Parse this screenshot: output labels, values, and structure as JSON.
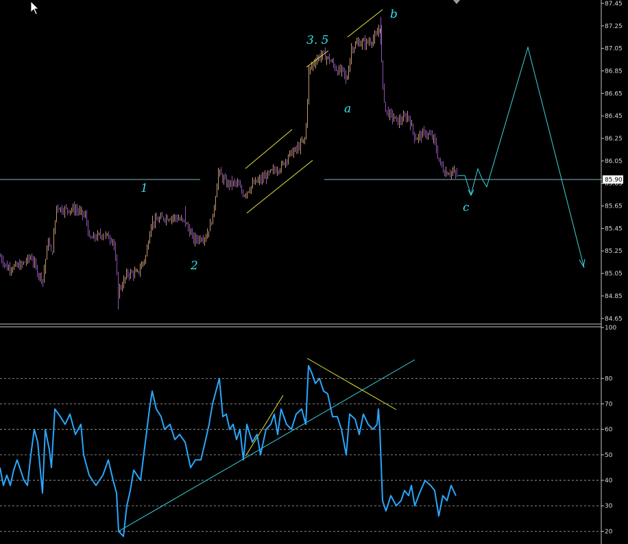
{
  "chart_data": [
    {
      "type": "bar",
      "style": "ohlc-price",
      "ylim": [
        84.6,
        87.48
      ],
      "yticks": [
        87.45,
        87.25,
        87.05,
        86.85,
        86.65,
        86.45,
        86.25,
        86.05,
        85.85,
        85.65,
        85.45,
        85.25,
        85.05,
        84.85,
        84.65
      ],
      "current_price": "85.90",
      "price_path": [
        [
          0,
          85.2
        ],
        [
          10,
          85.1
        ],
        [
          30,
          85.12
        ],
        [
          45,
          85.2
        ],
        [
          55,
          85.05
        ],
        [
          62,
          85.0
        ],
        [
          70,
          85.35
        ],
        [
          75,
          85.2
        ],
        [
          82,
          85.65
        ],
        [
          90,
          85.62
        ],
        [
          110,
          85.62
        ],
        [
          125,
          85.55
        ],
        [
          130,
          85.35
        ],
        [
          150,
          85.4
        ],
        [
          165,
          85.35
        ],
        [
          172,
          84.9
        ],
        [
          178,
          84.95
        ],
        [
          185,
          85.05
        ],
        [
          200,
          85.05
        ],
        [
          212,
          85.2
        ],
        [
          220,
          85.5
        ],
        [
          240,
          85.55
        ],
        [
          255,
          85.55
        ],
        [
          270,
          85.5
        ],
        [
          282,
          85.35
        ],
        [
          300,
          85.38
        ],
        [
          310,
          85.55
        ],
        [
          318,
          85.95
        ],
        [
          330,
          85.85
        ],
        [
          345,
          85.85
        ],
        [
          355,
          85.75
        ],
        [
          370,
          85.85
        ],
        [
          385,
          85.9
        ],
        [
          395,
          85.95
        ],
        [
          410,
          86.0
        ],
        [
          420,
          86.1
        ],
        [
          432,
          86.15
        ],
        [
          445,
          86.25
        ],
        [
          450,
          86.85
        ],
        [
          460,
          86.95
        ],
        [
          470,
          87.0
        ],
        [
          480,
          86.95
        ],
        [
          492,
          86.85
        ],
        [
          500,
          86.85
        ],
        [
          505,
          86.75
        ],
        [
          512,
          87.05
        ],
        [
          522,
          87.1
        ],
        [
          535,
          87.1
        ],
        [
          548,
          87.15
        ],
        [
          554,
          87.25
        ],
        [
          557,
          86.75
        ],
        [
          562,
          86.5
        ],
        [
          570,
          86.45
        ],
        [
          580,
          86.4
        ],
        [
          595,
          86.45
        ],
        [
          605,
          86.25
        ],
        [
          620,
          86.3
        ],
        [
          632,
          86.25
        ],
        [
          640,
          86.05
        ],
        [
          648,
          85.95
        ],
        [
          660,
          85.95
        ],
        [
          667,
          85.92
        ]
      ],
      "wave_labels": [
        "1",
        "2",
        "3. 5",
        "a",
        "b",
        "c"
      ],
      "projection": [
        [
          668,
          85.92
        ],
        [
          678,
          85.92
        ],
        [
          687,
          85.75
        ],
        [
          697,
          85.98
        ],
        [
          704,
          85.88
        ],
        [
          710,
          85.82
        ],
        [
          770,
          87.06
        ],
        [
          852,
          85.1
        ]
      ]
    },
    {
      "type": "line",
      "style": "oscillator",
      "ylim": [
        15,
        100
      ],
      "yticks": [
        100,
        80,
        70,
        60,
        50,
        40,
        30,
        20
      ],
      "gridlines": [
        80,
        70,
        60,
        50,
        40,
        30,
        20
      ],
      "line_color": "#2aa8ff",
      "values": [
        [
          0,
          45
        ],
        [
          5,
          38
        ],
        [
          10,
          42
        ],
        [
          15,
          38
        ],
        [
          20,
          44
        ],
        [
          25,
          48
        ],
        [
          30,
          44
        ],
        [
          35,
          40
        ],
        [
          40,
          38
        ],
        [
          45,
          50
        ],
        [
          50,
          60
        ],
        [
          55,
          55
        ],
        [
          62,
          35
        ],
        [
          66,
          60
        ],
        [
          72,
          52
        ],
        [
          75,
          45
        ],
        [
          80,
          68
        ],
        [
          88,
          65
        ],
        [
          95,
          62
        ],
        [
          102,
          66
        ],
        [
          110,
          58
        ],
        [
          118,
          62
        ],
        [
          122,
          50
        ],
        [
          130,
          42
        ],
        [
          140,
          38
        ],
        [
          150,
          42
        ],
        [
          158,
          48
        ],
        [
          165,
          40
        ],
        [
          170,
          35
        ],
        [
          173,
          20
        ],
        [
          180,
          18
        ],
        [
          185,
          30
        ],
        [
          190,
          36
        ],
        [
          195,
          44
        ],
        [
          205,
          40
        ],
        [
          212,
          55
        ],
        [
          218,
          68
        ],
        [
          222,
          75
        ],
        [
          228,
          68
        ],
        [
          235,
          65
        ],
        [
          240,
          60
        ],
        [
          248,
          62
        ],
        [
          255,
          56
        ],
        [
          262,
          58
        ],
        [
          270,
          55
        ],
        [
          278,
          45
        ],
        [
          285,
          48
        ],
        [
          293,
          48
        ],
        [
          300,
          56
        ],
        [
          305,
          62
        ],
        [
          310,
          70
        ],
        [
          315,
          75
        ],
        [
          320,
          80
        ],
        [
          325,
          65
        ],
        [
          330,
          66
        ],
        [
          335,
          60
        ],
        [
          340,
          62
        ],
        [
          345,
          56
        ],
        [
          350,
          60
        ],
        [
          355,
          48
        ],
        [
          360,
          62
        ],
        [
          368,
          55
        ],
        [
          375,
          58
        ],
        [
          380,
          50
        ],
        [
          388,
          60
        ],
        [
          395,
          62
        ],
        [
          400,
          66
        ],
        [
          405,
          58
        ],
        [
          410,
          68
        ],
        [
          418,
          62
        ],
        [
          425,
          60
        ],
        [
          432,
          66
        ],
        [
          440,
          68
        ],
        [
          446,
          62
        ],
        [
          450,
          85
        ],
        [
          455,
          82
        ],
        [
          460,
          78
        ],
        [
          466,
          80
        ],
        [
          472,
          75
        ],
        [
          478,
          74
        ],
        [
          485,
          65
        ],
        [
          492,
          65
        ],
        [
          498,
          60
        ],
        [
          505,
          50
        ],
        [
          510,
          66
        ],
        [
          518,
          64
        ],
        [
          524,
          58
        ],
        [
          530,
          66
        ],
        [
          537,
          62
        ],
        [
          544,
          60
        ],
        [
          550,
          62
        ],
        [
          552,
          68
        ],
        [
          554,
          60
        ],
        [
          558,
          32
        ],
        [
          563,
          28
        ],
        [
          570,
          34
        ],
        [
          578,
          30
        ],
        [
          585,
          32
        ],
        [
          590,
          36
        ],
        [
          596,
          34
        ],
        [
          600,
          38
        ],
        [
          605,
          30
        ],
        [
          612,
          35
        ],
        [
          620,
          40
        ],
        [
          628,
          38
        ],
        [
          634,
          36
        ],
        [
          640,
          26
        ],
        [
          646,
          34
        ],
        [
          652,
          32
        ],
        [
          658,
          38
        ],
        [
          665,
          34
        ]
      ]
    }
  ],
  "colors": {
    "background": "#000000",
    "bar_up": "#c89a70",
    "bar_down": "#8e55b8",
    "trend_yellow": "#e8e83a",
    "trend_cyan": "#3ad6e0",
    "price_line": "#7fb8c8",
    "wave_text": "#35e0e8",
    "panel_divider": "#c8c8c8",
    "grid_dash": "#b0b0b0"
  },
  "icons": [
    "mouse-cursor-icon",
    "scroll-marker-icon"
  ]
}
